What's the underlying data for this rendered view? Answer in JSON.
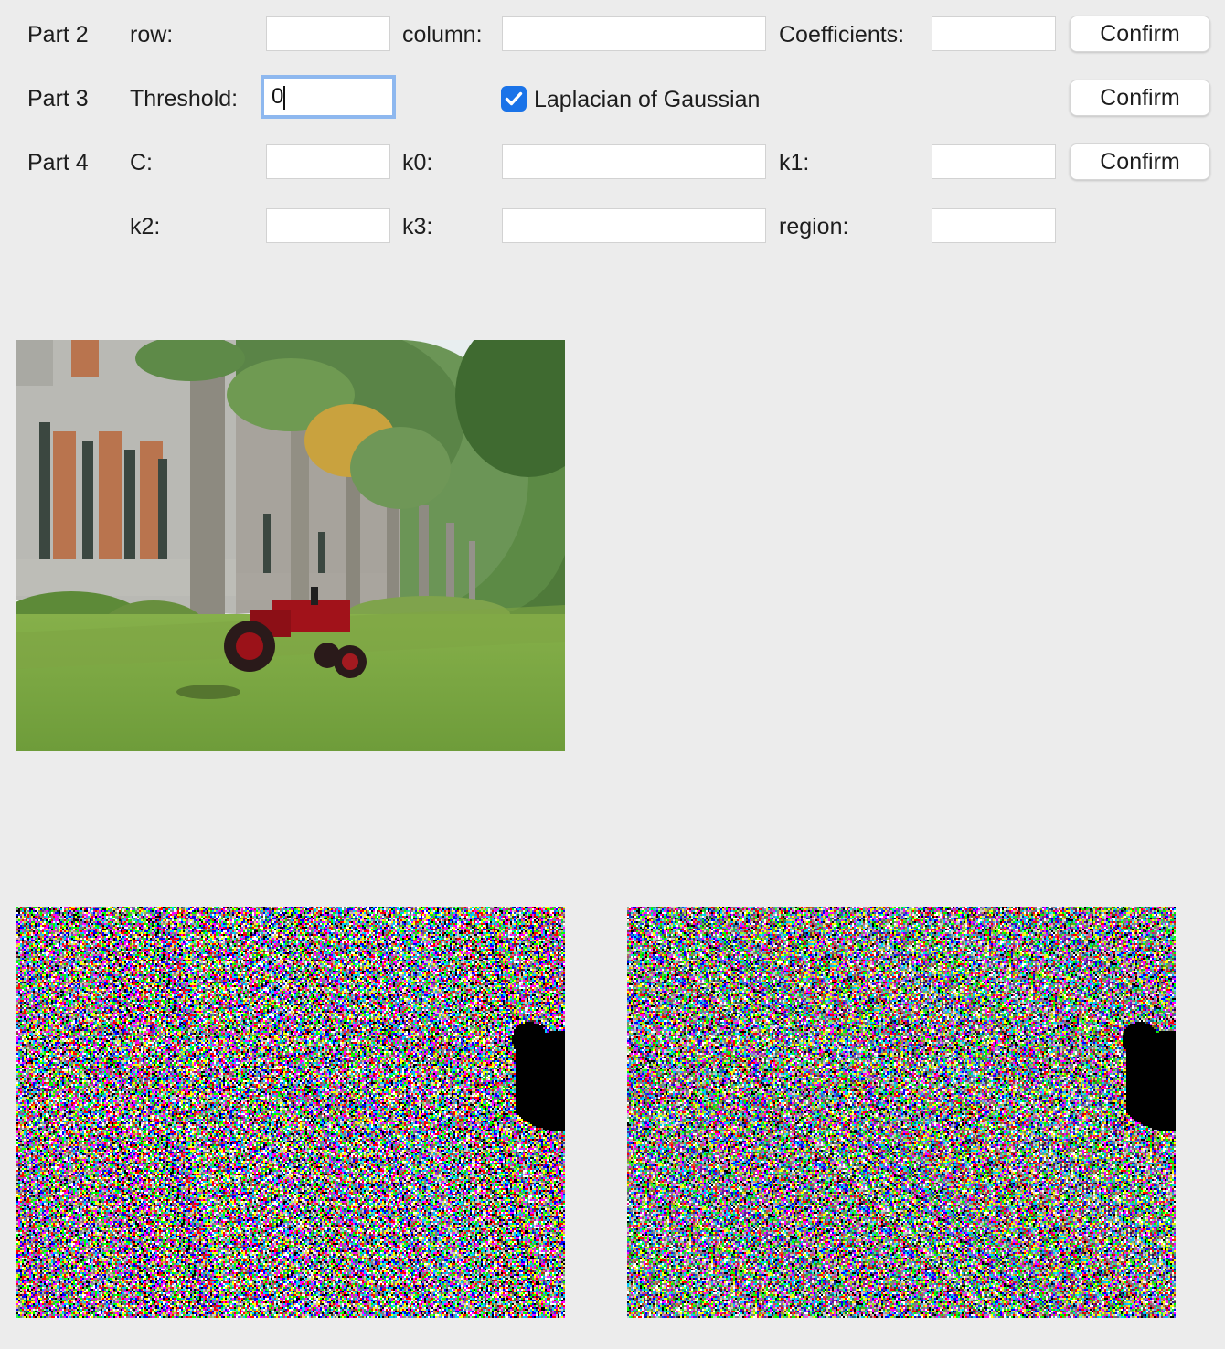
{
  "part2": {
    "section_label": "Part 2",
    "row_label": "row:",
    "row_value": "",
    "column_label": "column:",
    "column_value": "",
    "coefficients_label": "Coefficients:",
    "coefficients_value": "",
    "confirm_label": "Confirm"
  },
  "part3": {
    "section_label": "Part 3",
    "threshold_label": "Threshold:",
    "threshold_value": "0",
    "log_checkbox_label": "Laplacian of Gaussian",
    "log_checked": true,
    "confirm_label": "Confirm"
  },
  "part4": {
    "section_label": "Part 4",
    "c_label": "C:",
    "c_value": "",
    "k0_label": "k0:",
    "k0_value": "",
    "k1_label": "k1:",
    "k1_value": "",
    "k2_label": "k2:",
    "k2_value": "",
    "k3_label": "k3:",
    "k3_value": "",
    "region_label": "region:",
    "region_value": "",
    "confirm_label": "Confirm"
  },
  "images": {
    "original": "photo of a red tractor on grass under palm trees beside a brick building",
    "result_left": "noisy colour edge-detection output",
    "result_right": "noisy colour edge-detection output"
  },
  "colors": {
    "background": "#ececec",
    "accent": "#1a73e8",
    "focus_ring": "#8eb8ef"
  }
}
